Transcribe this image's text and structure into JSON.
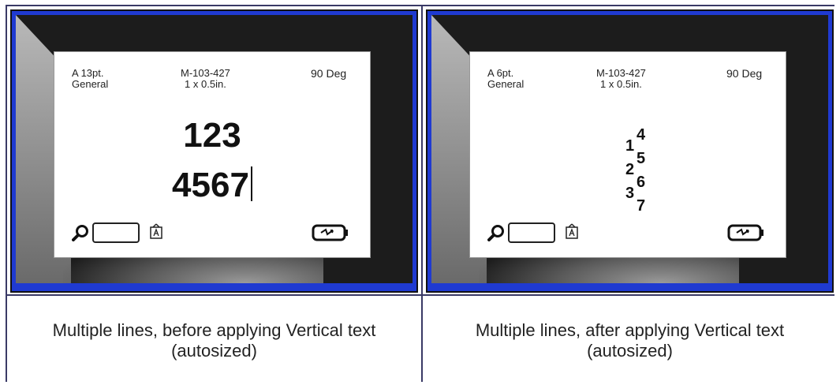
{
  "panels": [
    {
      "header": {
        "font_size": "A 13pt.",
        "font_name": "General",
        "part_number": "M-103-427",
        "label_size": "1 x 0.5in.",
        "rotation": "90 Deg"
      },
      "lines": [
        "123",
        "4567"
      ],
      "caption_line1": "Multiple lines, before applying Vertical text",
      "caption_line2": "(autosized)"
    },
    {
      "header": {
        "font_size": "A 6pt.",
        "font_name": "General",
        "part_number": "M-103-427",
        "label_size": "1 x 0.5in.",
        "rotation": "90 Deg"
      },
      "vertical_chars": {
        "d4": "4",
        "d1": "1",
        "d5": "5",
        "d2": "2",
        "d6": "6",
        "d3": "3",
        "d7": "7"
      },
      "caption_line1": "Multiple lines, after applying Vertical text",
      "caption_line2": "(autosized)"
    }
  ],
  "icons": {
    "magnifier": "magnifier-icon",
    "tape": "tape-cartridge-icon",
    "label": "label-icon",
    "battery": "battery-icon"
  },
  "colors": {
    "bezel": "#1f3ad1",
    "divider": "#3a3a66"
  }
}
